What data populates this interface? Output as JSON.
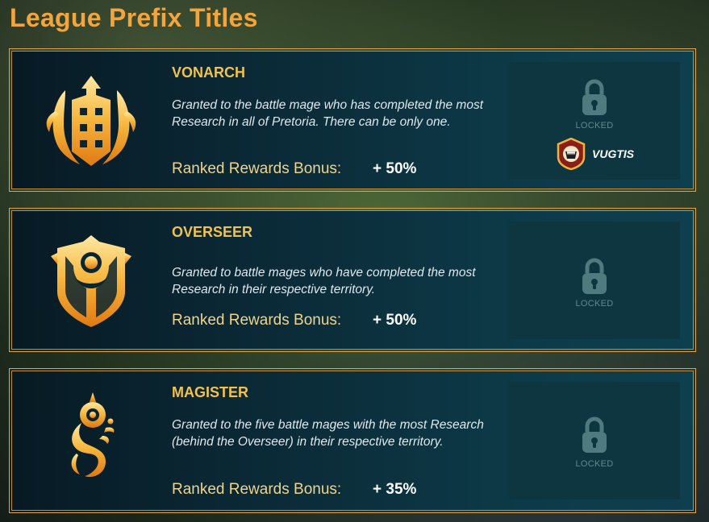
{
  "page": {
    "title": "League Prefix Titles"
  },
  "cards": [
    {
      "title": "VONARCH",
      "description": "Granted to the battle mage who has completed the most Research in all of Pretoria. There can be only one.",
      "bonus_label": "Ranked Rewards Bonus:",
      "bonus_value": "+ 50%",
      "lock_text": "LOCKED",
      "holder_name": "VUGTIS",
      "emblem": "vonarch-emblem-icon"
    },
    {
      "title": "OVERSEER",
      "description": "Granted to battle mages who have completed the most Research in their respective territory.",
      "bonus_label": "Ranked Rewards Bonus:",
      "bonus_value": "+ 50%",
      "lock_text": "LOCKED",
      "emblem": "overseer-emblem-icon"
    },
    {
      "title": "MAGISTER",
      "description": "Granted to the five battle mages with the most Research (behind the Overseer) in their respective territory.",
      "bonus_label": "Ranked Rewards Bonus:",
      "bonus_value": "+ 35%",
      "lock_text": "LOCKED",
      "emblem": "magister-emblem-icon"
    }
  ],
  "colors": {
    "accent_gold": "#f2a53a",
    "title_yellow": "#f1c24c",
    "card_border": "#e3a348",
    "lock_gray": "#5f8a8f"
  }
}
